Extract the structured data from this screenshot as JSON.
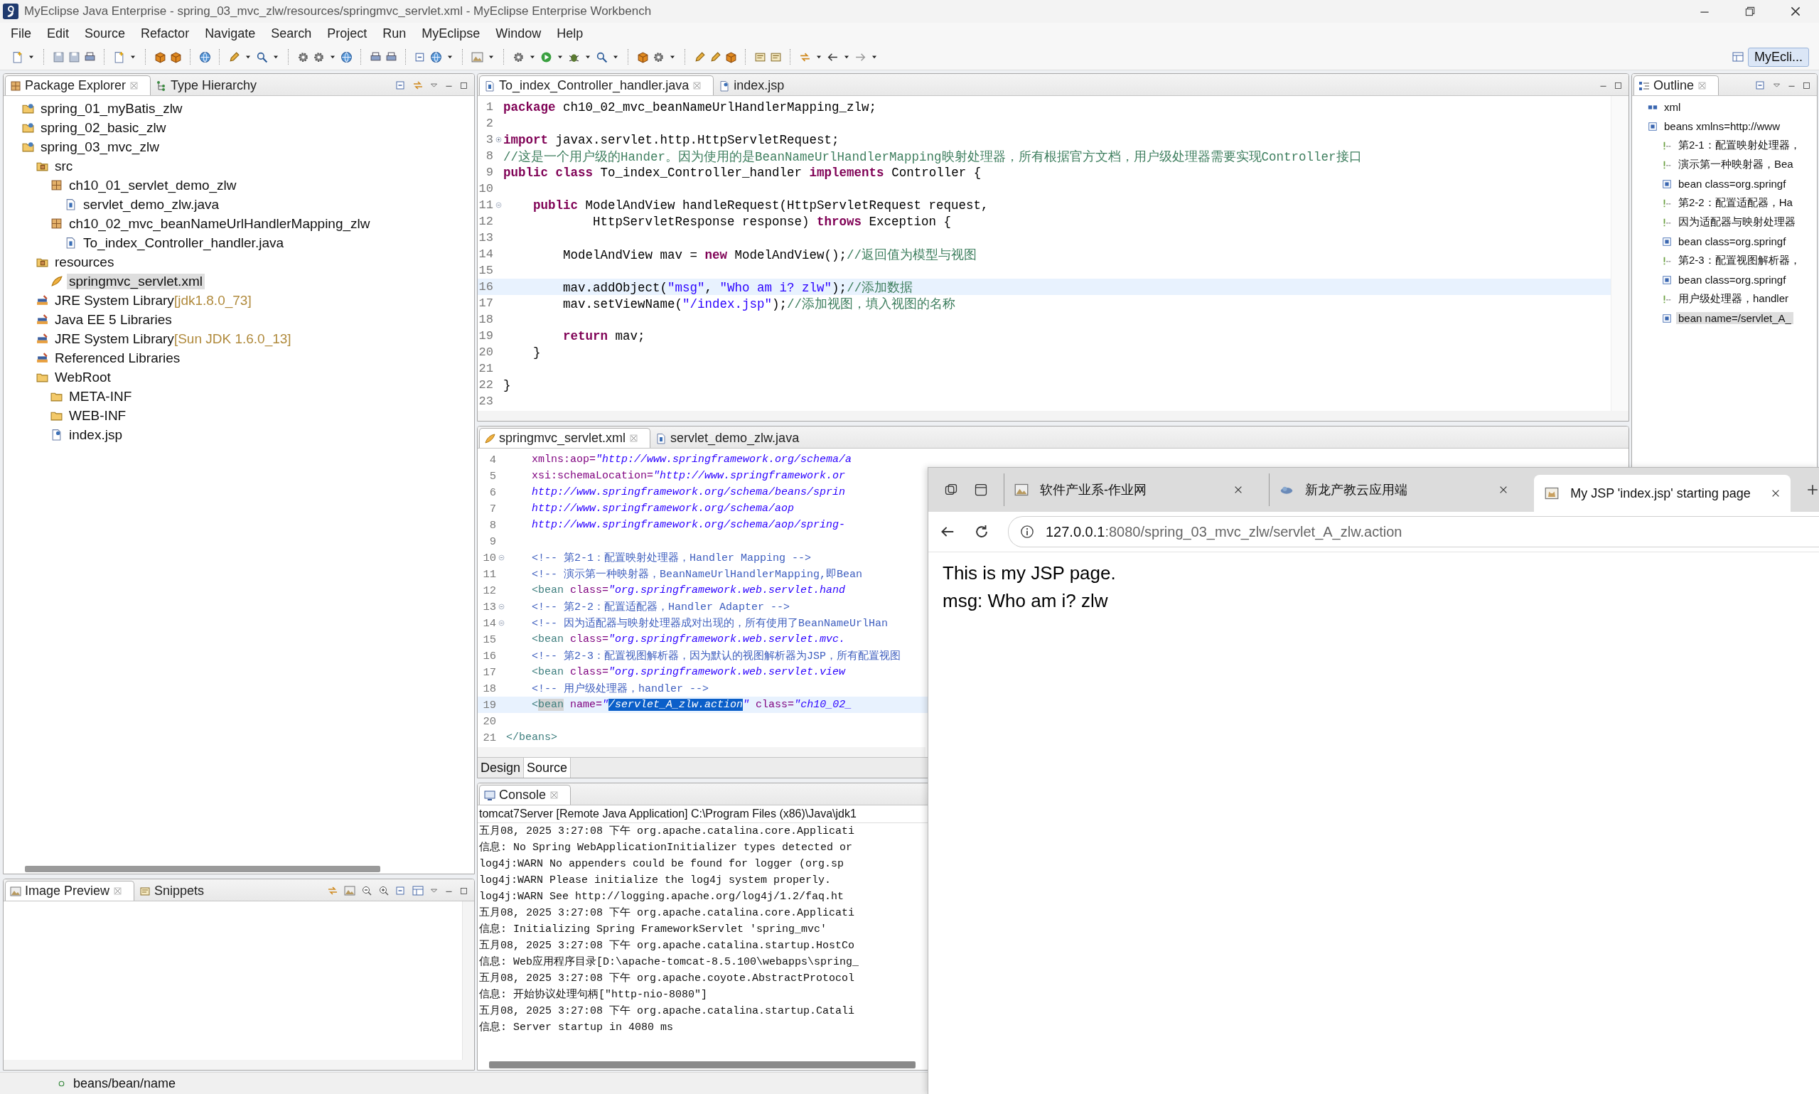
{
  "window": {
    "title": "MyEclipse Java Enterprise - spring_03_mvc_zlw/resources/springmvc_servlet.xml - MyEclipse Enterprise Workbench"
  },
  "menu": [
    "File",
    "Edit",
    "Source",
    "Refactor",
    "Navigate",
    "Search",
    "Project",
    "Run",
    "MyEclipse",
    "Window",
    "Help"
  ],
  "perspective": {
    "label": "MyEcli...",
    "selected": true
  },
  "package_explorer": {
    "tabs": [
      {
        "label": "Package Explorer",
        "kind": "package",
        "selected": true
      },
      {
        "label": "Type Hierarchy",
        "kind": "hierarchy",
        "selected": false
      }
    ],
    "tree": [
      {
        "label": "spring_01_myBatis_zlw",
        "kind": "project",
        "selected": false
      },
      {
        "label": "spring_02_basic_zlw",
        "kind": "project",
        "selected": false
      },
      {
        "label": "spring_03_mvc_zlw",
        "kind": "project",
        "selected": false,
        "children": [
          {
            "label": "src",
            "kind": "srcfolder",
            "selected": false,
            "children": [
              {
                "label": "ch10_01_servlet_demo_zlw",
                "kind": "package",
                "selected": false,
                "children": [
                  {
                    "label": "servlet_demo_zlw.java",
                    "kind": "java",
                    "selected": false
                  }
                ]
              },
              {
                "label": "ch10_02_mvc_beanNameUrlHandlerMapping_zlw",
                "kind": "package",
                "selected": false,
                "children": [
                  {
                    "label": "To_index_Controller_handler.java",
                    "kind": "java",
                    "selected": false
                  }
                ]
              }
            ]
          },
          {
            "label": "resources",
            "kind": "srcfolder",
            "selected": false,
            "children": [
              {
                "label": "springmvc_servlet.xml",
                "kind": "xml",
                "selected": true
              }
            ]
          },
          {
            "label": "JRE System Library",
            "decoration": "[jdk1.8.0_73]",
            "kind": "library",
            "selected": false
          },
          {
            "label": "Java EE 5 Libraries",
            "kind": "library",
            "selected": false
          },
          {
            "label": "JRE System Library",
            "decoration": "[Sun JDK 1.6.0_13]",
            "kind": "library",
            "selected": false
          },
          {
            "label": "Referenced Libraries",
            "kind": "library",
            "selected": false
          },
          {
            "label": "WebRoot",
            "kind": "folder",
            "selected": false,
            "children": [
              {
                "label": "META-INF",
                "kind": "folder",
                "selected": false
              },
              {
                "label": "WEB-INF",
                "kind": "folder",
                "selected": false
              },
              {
                "label": "index.jsp",
                "kind": "jsp",
                "selected": false
              }
            ]
          }
        ]
      }
    ]
  },
  "image_preview": {
    "tabs": [
      {
        "label": "Image Preview",
        "kind": "image",
        "selected": true
      },
      {
        "label": "Snippets",
        "kind": "snippet",
        "selected": false
      }
    ]
  },
  "editor": {
    "tabs": [
      {
        "label": "To_index_Controller_handler.java",
        "kind": "java",
        "selected": true
      },
      {
        "label": "index.jsp",
        "kind": "jsp",
        "selected": false
      }
    ],
    "lines": [
      {
        "number": "1",
        "current": false,
        "tokens": [
          {
            "kind": "keyword",
            "text": "package"
          },
          {
            "kind": "plain",
            "text": " ch10_02_mvc_beanNameUrlHandlerMapping_zlw;"
          }
        ]
      },
      {
        "number": "2",
        "current": false
      },
      {
        "number": "3",
        "current": false,
        "kind": "collapsed",
        "tokens": [
          {
            "kind": "keyword",
            "text": "import"
          },
          {
            "kind": "plain",
            "text": " javax.servlet.http.HttpServletRequest;"
          }
        ]
      },
      {
        "number": "8",
        "current": false,
        "tokens": [
          {
            "kind": "comment",
            "text": "//这是一个用户级的Hander。因为使用的是BeanNameUrlHandlerMapping映射处理器，所有根据官方文档，用户级处理器需要实现Controller接口"
          }
        ]
      },
      {
        "number": "9",
        "current": false,
        "tokens": [
          {
            "kind": "keyword",
            "text": "public class"
          },
          {
            "kind": "plain",
            "text": " To_index_Controller_handler "
          },
          {
            "kind": "keyword",
            "text": "implements"
          },
          {
            "kind": "plain",
            "text": " Controller {"
          }
        ]
      },
      {
        "number": "10",
        "current": false
      },
      {
        "number": "11",
        "current": false,
        "kind": "expanded",
        "tokens": [
          {
            "kind": "keyword",
            "text": "    public"
          },
          {
            "kind": "plain",
            "text": " ModelAndView handleRequest(HttpServletRequest request,"
          }
        ]
      },
      {
        "number": "12",
        "current": false,
        "tokens": [
          {
            "kind": "plain",
            "text": "            HttpServletResponse response) "
          },
          {
            "kind": "keyword",
            "text": "throws"
          },
          {
            "kind": "plain",
            "text": " Exception {"
          }
        ]
      },
      {
        "number": "13",
        "current": false
      },
      {
        "number": "14",
        "current": false,
        "tokens": [
          {
            "kind": "plain",
            "text": "        ModelAndView mav = "
          },
          {
            "kind": "keyword",
            "text": "new"
          },
          {
            "kind": "plain",
            "text": " ModelAndView();"
          },
          {
            "kind": "comment",
            "text": "//返回值为模型与视图"
          }
        ]
      },
      {
        "number": "15",
        "current": false
      },
      {
        "number": "16",
        "current": true,
        "tokens": [
          {
            "kind": "plain",
            "text": "        mav.addObject("
          },
          {
            "kind": "string",
            "text": "\"msg\""
          },
          {
            "kind": "plain",
            "text": ", "
          },
          {
            "kind": "string",
            "text": "\"Who am i? zlw\""
          },
          {
            "kind": "plain",
            "text": ");"
          },
          {
            "kind": "comment",
            "text": "//添加数据"
          }
        ]
      },
      {
        "number": "17",
        "current": false,
        "tokens": [
          {
            "kind": "plain",
            "text": "        mav.setViewName("
          },
          {
            "kind": "string",
            "text": "\"/index.jsp\""
          },
          {
            "kind": "plain",
            "text": ");"
          },
          {
            "kind": "comment",
            "text": "//添加视图，填入视图的名称"
          }
        ]
      },
      {
        "number": "18",
        "current": false
      },
      {
        "number": "19",
        "current": false,
        "tokens": [
          {
            "kind": "keyword",
            "text": "        return"
          },
          {
            "kind": "plain",
            "text": " mav;"
          }
        ]
      },
      {
        "number": "20",
        "current": false,
        "tokens": [
          {
            "kind": "plain",
            "text": "    }"
          }
        ]
      },
      {
        "number": "21",
        "current": false
      },
      {
        "number": "22",
        "current": false,
        "tokens": [
          {
            "kind": "plain",
            "text": "}"
          }
        ]
      },
      {
        "number": "23",
        "current": false
      }
    ]
  },
  "xml_editor": {
    "tabs": [
      {
        "label": "springmvc_servlet.xml",
        "kind": "xml",
        "selected": true
      },
      {
        "label": "servlet_demo_zlw.java",
        "kind": "java",
        "selected": false
      }
    ],
    "lines": [
      {
        "number": "4",
        "current": false,
        "tokens": [
          {
            "kind": "attr",
            "text": "    xmlns:aop="
          },
          {
            "kind": "value",
            "text": "\"http://www.springframework.org/schema/a"
          }
        ]
      },
      {
        "number": "5",
        "current": false,
        "tokens": [
          {
            "kind": "attr",
            "text": "    xsi:schemaLocation="
          },
          {
            "kind": "value",
            "text": "\"http://www.springframework.or"
          }
        ]
      },
      {
        "number": "6",
        "current": false,
        "tokens": [
          {
            "kind": "value",
            "text": "    http://www.springframework.org/schema/beans/sprin"
          }
        ]
      },
      {
        "number": "7",
        "current": false,
        "tokens": [
          {
            "kind": "value",
            "text": "    http://www.springframework.org/schema/aop"
          }
        ]
      },
      {
        "number": "8",
        "current": false,
        "tokens": [
          {
            "kind": "value",
            "text": "    http://www.springframework.org/schema/aop/spring-"
          }
        ]
      },
      {
        "number": "9",
        "current": false
      },
      {
        "number": "10",
        "current": false,
        "kind": "expanded",
        "tokens": [
          {
            "kind": "xmlcomment",
            "text": "    <!-- 第2-1：配置映射处理器，Handler Mapping -->"
          }
        ]
      },
      {
        "number": "11",
        "current": false,
        "tokens": [
          {
            "kind": "xmlcomment",
            "text": "    <!-- 演示第一种映射器，BeanNameUrlHandlerMapping,即Bean"
          }
        ]
      },
      {
        "number": "12",
        "current": false,
        "tokens": [
          {
            "kind": "tag",
            "text": "    <bean "
          },
          {
            "kind": "attr",
            "text": "class="
          },
          {
            "kind": "value",
            "text": "\"org.springframework.web.servlet.hand"
          }
        ]
      },
      {
        "number": "13",
        "current": false,
        "kind": "expanded",
        "tokens": [
          {
            "kind": "xmlcomment",
            "text": "    <!-- 第2-2：配置适配器，Handler Adapter -->"
          }
        ]
      },
      {
        "number": "14",
        "current": false,
        "kind": "expanded",
        "tokens": [
          {
            "kind": "xmlcomment",
            "text": "    <!-- 因为适配器与映射处理器成对出现的，所有使用了BeanNameUrlHan"
          }
        ]
      },
      {
        "number": "15",
        "current": false,
        "tokens": [
          {
            "kind": "tag",
            "text": "    <bean "
          },
          {
            "kind": "attr",
            "text": "class="
          },
          {
            "kind": "value",
            "text": "\"org.springframework.web.servlet.mvc."
          }
        ]
      },
      {
        "number": "16",
        "current": false,
        "tokens": [
          {
            "kind": "xmlcomment",
            "text": "    <!-- 第2-3：配置视图解析器，因为默认的视图解析器为JSP，所有配置视图"
          }
        ]
      },
      {
        "number": "17",
        "current": false,
        "tokens": [
          {
            "kind": "tag",
            "text": "    <bean "
          },
          {
            "kind": "attr",
            "text": "class="
          },
          {
            "kind": "value",
            "text": "\"org.springframework.web.servlet.view"
          }
        ]
      },
      {
        "number": "18",
        "current": false,
        "tokens": [
          {
            "kind": "xmlcomment",
            "text": "    <!-- 用户级处理器，handler -->"
          }
        ]
      },
      {
        "number": "19",
        "current": true,
        "tokens": [
          {
            "kind": "tag",
            "text": "    <"
          },
          {
            "kind": "match",
            "text": "bean"
          },
          {
            "kind": "attr",
            "text": " name="
          },
          {
            "kind": "value",
            "text": "\""
          },
          {
            "kind": "selection",
            "text": "/servlet_A_zlw.action"
          },
          {
            "kind": "value",
            "text": "\""
          },
          {
            "kind": "attr",
            "text": " class="
          },
          {
            "kind": "value",
            "text": "\"ch10_02_"
          }
        ]
      },
      {
        "number": "20",
        "current": false
      },
      {
        "number": "21",
        "current": false,
        "tokens": [
          {
            "kind": "tag",
            "text": "</beans>"
          }
        ]
      }
    ],
    "modes": [
      {
        "label": "Design",
        "selected": false
      },
      {
        "label": "Source",
        "selected": true
      }
    ]
  },
  "console": {
    "tabs": [
      {
        "label": "Console",
        "kind": "console",
        "selected": true
      }
    ],
    "process": "tomcat7Server [Remote Java Application] C:\\Program Files (x86)\\Java\\jdk1",
    "lines": [
      "五月08, 2025 3:27:08 下午 org.apache.catalina.core.Applicati",
      "信息: No Spring WebApplicationInitializer types detected or",
      "log4j:WARN No appenders could be found for logger (org.sp",
      "log4j:WARN Please initialize the log4j system properly.",
      "log4j:WARN See http://logging.apache.org/log4j/1.2/faq.ht",
      "五月08, 2025 3:27:08 下午 org.apache.catalina.core.Applicati",
      "信息: Initializing Spring FrameworkServlet 'spring_mvc'",
      "五月08, 2025 3:27:08 下午 org.apache.catalina.startup.HostCo",
      "信息: Web应用程序目录[D:\\apache-tomcat-8.5.100\\webapps\\spring_",
      "五月08, 2025 3:27:08 下午 org.apache.coyote.AbstractProtocol",
      "信息: 开始协议处理句柄[\"http-nio-8080\"]",
      "五月08, 2025 3:27:08 下午 org.apache.catalina.startup.Catali",
      "信息: Server startup in 4080 ms"
    ]
  },
  "outline": {
    "tabs": [
      {
        "label": "Outline",
        "kind": "outline",
        "selected": true
      }
    ],
    "tree": [
      {
        "label": "xml",
        "kind": "pi",
        "selected": false
      },
      {
        "label": "beans xmlns=http://www",
        "kind": "element",
        "selected": false,
        "children": [
          {
            "label": "第2-1：配置映射处理器，",
            "kind": "comment",
            "selected": false
          },
          {
            "label": "演示第一种映射器，Bea",
            "kind": "comment",
            "selected": false
          },
          {
            "label": "bean class=org.springf",
            "kind": "element",
            "selected": false
          },
          {
            "label": "第2-2：配置适配器，Ha",
            "kind": "comment",
            "selected": false
          },
          {
            "label": "因为适配器与映射处理器",
            "kind": "comment",
            "selected": false
          },
          {
            "label": "bean class=org.springf",
            "kind": "element",
            "selected": false
          },
          {
            "label": "第2-3：配置视图解析器，",
            "kind": "comment",
            "selected": false
          },
          {
            "label": "bean class=org.springf",
            "kind": "element",
            "selected": false
          },
          {
            "label": "用户级处理器，handler",
            "kind": "comment",
            "selected": false
          },
          {
            "label": "bean name=/servlet_A_",
            "kind": "element",
            "selected": true
          }
        ]
      }
    ]
  },
  "status_bar": {
    "text": "beans/bean/name"
  },
  "browser": {
    "tabs": [
      {
        "title": "软件产业系-作业网",
        "kind": "image",
        "selected": false
      },
      {
        "title": "新龙产教云应用端",
        "kind": "cloud",
        "selected": false
      },
      {
        "title": "My JSP 'index.jsp' starting page",
        "kind": "cat",
        "selected": true
      }
    ],
    "address": {
      "host": "127.0.0.1",
      "path": ":8080/spring_03_mvc_zlw/servlet_A_zlw.action"
    },
    "content": [
      "This is my JSP page.",
      "msg: Who am i? zlw"
    ]
  }
}
